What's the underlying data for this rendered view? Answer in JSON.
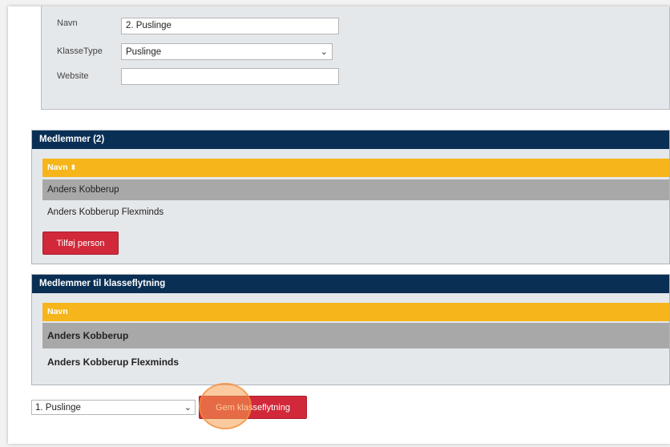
{
  "form": {
    "navn_label": "Navn",
    "navn_value": "2. Puslinge",
    "klassetype_label": "KlasseType",
    "klassetype_value": "Puslinge",
    "website_label": "Website",
    "website_value": ""
  },
  "members": {
    "title": "Medlemmer (2)",
    "column_header": "Navn",
    "sort_icon": "sort-icon",
    "rows": [
      "Anders Kobberup",
      "Anders Kobberup Flexminds"
    ],
    "add_button": "Tilføj person"
  },
  "transfer": {
    "title": "Medlemmer til klasseflytning",
    "column_header": "Navn",
    "rows": [
      "Anders Kobberup",
      "Anders Kobberup Flexminds"
    ]
  },
  "footer": {
    "class_select_value": "1. Puslinge",
    "save_button": "Gem klasseflytning"
  },
  "colors": {
    "header_navy": "#0a2f55",
    "table_header_amber": "#f5b51b",
    "button_red": "#d1293a"
  }
}
